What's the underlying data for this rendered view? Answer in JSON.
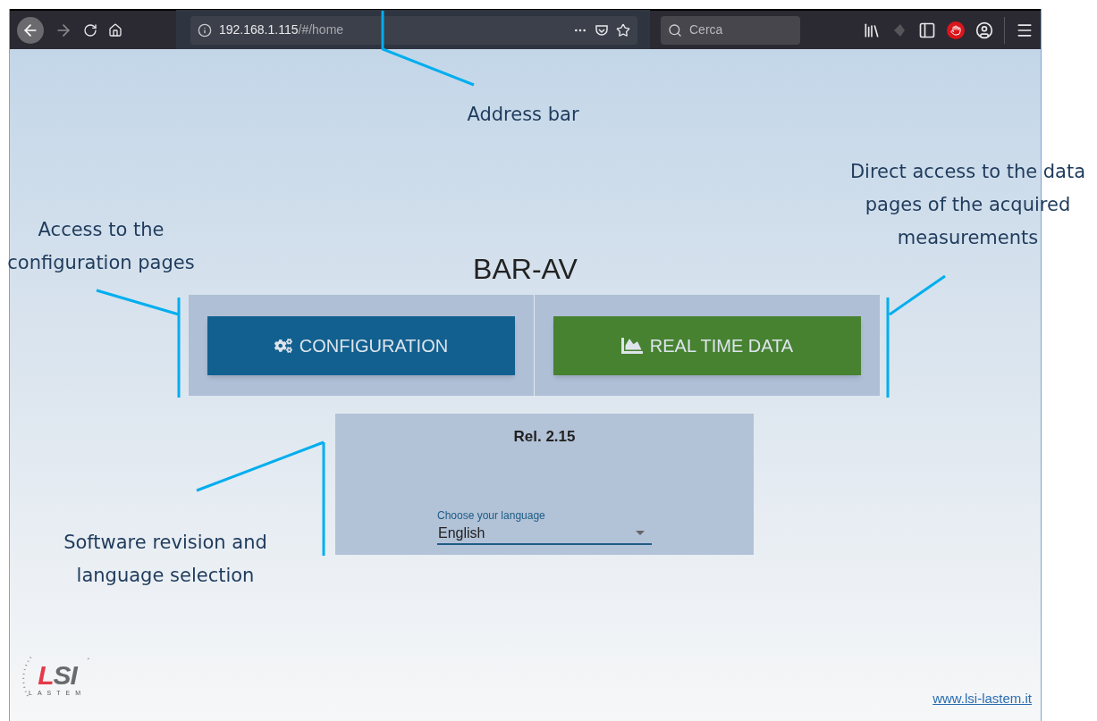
{
  "browser": {
    "url_host": "192.168.1.115",
    "url_path": "/#/home",
    "search_placeholder": "Cerca"
  },
  "page": {
    "title": "BAR-AV",
    "buttons": [
      {
        "kind": "config",
        "label": "CONFIGURATION"
      },
      {
        "kind": "data",
        "label": "REAL TIME DATA"
      }
    ],
    "release": "Rel. 2.15",
    "language": {
      "label": "Choose your language",
      "value": "English"
    },
    "logo": {
      "main": "LSI",
      "sub": "LASTEM"
    },
    "footer_link": "www.lsi-lastem.it"
  },
  "annotations": [
    {
      "kind": "address",
      "lines": [
        "Address bar"
      ]
    },
    {
      "kind": "config",
      "lines": [
        "Access to the",
        "configuration pages"
      ]
    },
    {
      "kind": "data",
      "lines": [
        "Direct access to the data",
        "pages of the acquired",
        "measurements"
      ]
    },
    {
      "kind": "release",
      "lines": [
        "Software revision and",
        "language selection"
      ]
    }
  ]
}
